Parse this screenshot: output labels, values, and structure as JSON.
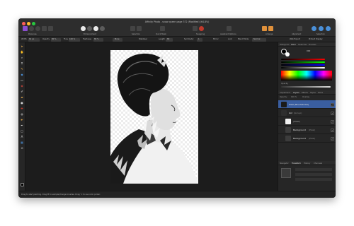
{
  "window": {
    "title": "Affinity Photo - snow queen page 372 (Modified) (64.8%)"
  },
  "toolbar": {
    "personas_label": "Personas",
    "enhancement_label": "Enhancement",
    "selection_label": "Selection",
    "quick_mask_label": "Quick Mask",
    "snapping_label": "Snapping",
    "assistant_label": "Assistant Options",
    "arrange_label": "Arrange",
    "alignment_label": "Alignment",
    "selection_right_label": "Selection",
    "web_export_label": "Web Export",
    "protect_label": "Protect Display"
  },
  "context": {
    "width_label": "Width",
    "width_value": "62 px",
    "opacity_label": "Opacity",
    "opacity_value": "80 %",
    "flow_label": "Flow",
    "flow_value": "100 %",
    "hardness_label": "Hardness",
    "hardness_value": "80 %",
    "more_label": "More",
    "stabiliser_label": "Stabiliser",
    "length_label": "Length",
    "length_value": "80",
    "symmetry_label": "Symmetry",
    "symmetry_value": "1",
    "mirror_label": "Mirror",
    "lock_label": "Lock",
    "blend_label": "Blend Mode",
    "blend_value": "Normal"
  },
  "panel": {
    "color_tabs": [
      "Histogram",
      "Color",
      "Swatches",
      "Brushes"
    ],
    "hex_value": "000",
    "opacity_label": "Opacity",
    "layer_tabs": [
      "Adjustment",
      "Layers",
      "Effects",
      "Styles",
      "Stock"
    ],
    "layers_header_labels": [
      "Opacity:",
      "100 %",
      "Overlay"
    ],
    "layers": [
      {
        "name": "Pixel (Brushstroke)",
        "kind": "(Pixel)",
        "selected": true
      },
      {
        "name": "Girl",
        "kind": "(Group)",
        "selected": false
      },
      {
        "name": "(Mask)",
        "kind": "",
        "selected": false
      },
      {
        "name": "Background",
        "kind": "(Pixel)",
        "selected": false
      },
      {
        "name": "Background",
        "kind": "(Pixel)",
        "selected": false
      }
    ],
    "nav_tabs": [
      "Navigator",
      "Transform",
      "History",
      "Channels"
    ]
  },
  "status": {
    "text": "Drag to start painting. Drag ⌘ to sample/change brushes. Drag ⌥ to use color picker."
  },
  "colors": {
    "accent": "#3a5ea0",
    "chrome": "#262626",
    "canvas_bg": "#1c1c1c",
    "document": "#ffffff"
  }
}
